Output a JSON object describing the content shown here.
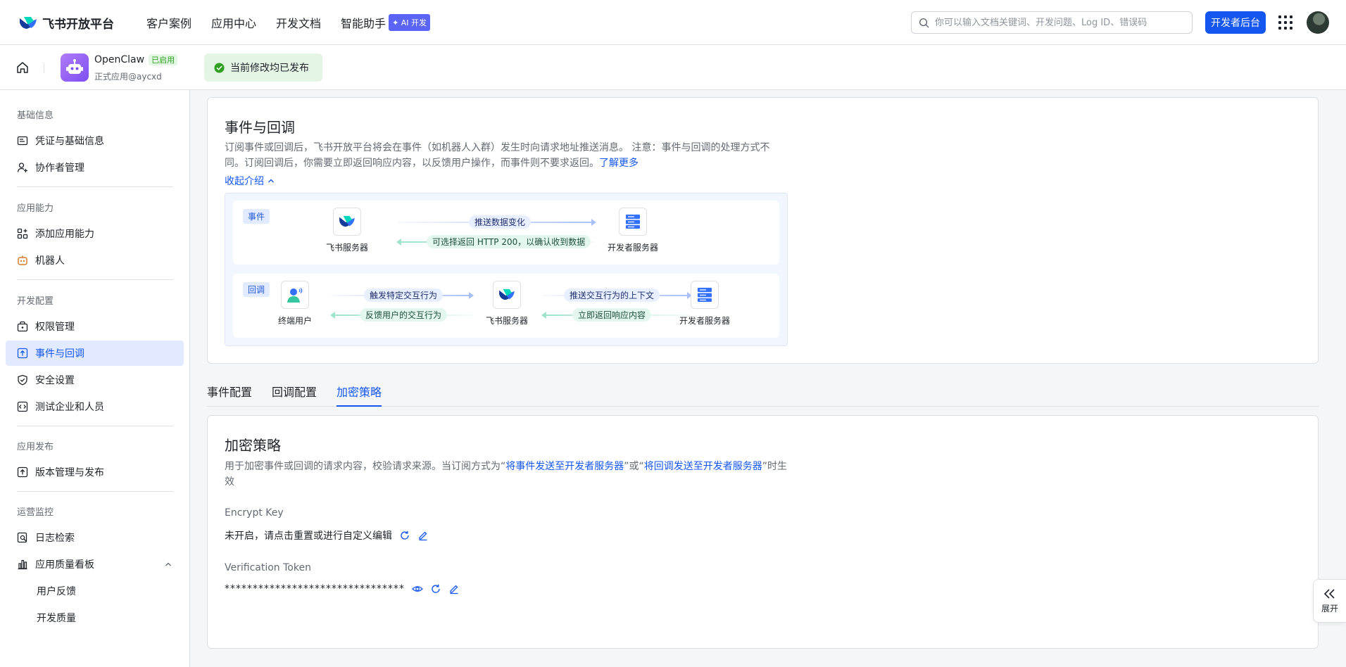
{
  "topbar": {
    "brand": "飞书开放平台",
    "nav": [
      "客户案例",
      "应用中心",
      "开发文档",
      "智能助手"
    ],
    "ai_badge": "✦ AI 开发",
    "search_placeholder": "你可以输入文档关键词、开发问题、Log ID、错误码",
    "dev_console": "开发者后台"
  },
  "app": {
    "name": "OpenClaw",
    "status": "已启用",
    "subtitle": "正式应用@aycxd",
    "publish_tip": "当前修改均已发布"
  },
  "sidebar": {
    "groups": {
      "basic": "基础信息",
      "capability": "应用能力",
      "dev": "开发配置",
      "release": "应用发布",
      "ops": "运营监控"
    },
    "items": {
      "credentials": "凭证与基础信息",
      "collaborators": "协作者管理",
      "add_capability": "添加应用能力",
      "bot": "机器人",
      "permissions": "权限管理",
      "events": "事件与回调",
      "security": "安全设置",
      "test_org": "测试企业和人员",
      "versions": "版本管理与发布",
      "logs": "日志检索",
      "quality": "应用质量看板",
      "feedback": "用户反馈",
      "dev_quality": "开发质量"
    }
  },
  "intro": {
    "title": "事件与回调",
    "desc_line1": "订阅事件或回调后，飞书开放平台将会在事件（如机器人入群）发生时向请求地址推送消息。 注意：事件与回调的处理方式不",
    "desc_line2": "同。订阅回调后，你需要立即返回响应内容，以反馈用户操作，而事件则不要求返回。",
    "learn_more": "了解更多",
    "collapse": "收起介绍",
    "event_tag": "事件",
    "callback_tag": "回调",
    "feishu_server": "飞书服务器",
    "dev_server": "开发者服务器",
    "end_user": "终端用户",
    "push_data": "推送数据变化",
    "optional_return": "可选择返回 HTTP 200，以确认收到数据",
    "trigger": "触发特定交互行为",
    "feedback": "反馈用户的交互行为",
    "push_context": "推送交互行为的上下文",
    "return_now": "立即返回响应内容"
  },
  "tabs": [
    "事件配置",
    "回调配置",
    "加密策略"
  ],
  "encryption": {
    "title": "加密策略",
    "desc_a": "用于加密事件或回调的请求内容，校验请求来源。当订阅方式为“",
    "desc_link1": "将事件发送至开发者服务器",
    "desc_b": "”或“",
    "desc_link2": "将回调发送至开发者服务器",
    "desc_c": "”时生",
    "desc_d": "效",
    "encrypt_key_label": "Encrypt Key",
    "encrypt_key_value": "未开启，请点击重置或进行自定义编辑",
    "token_label": "Verification Token",
    "token_value": "********************************"
  },
  "expand_label": "展开",
  "colors": {
    "primary": "#1456f0",
    "success": "#2ea121",
    "active_bg": "#e1eaff"
  }
}
